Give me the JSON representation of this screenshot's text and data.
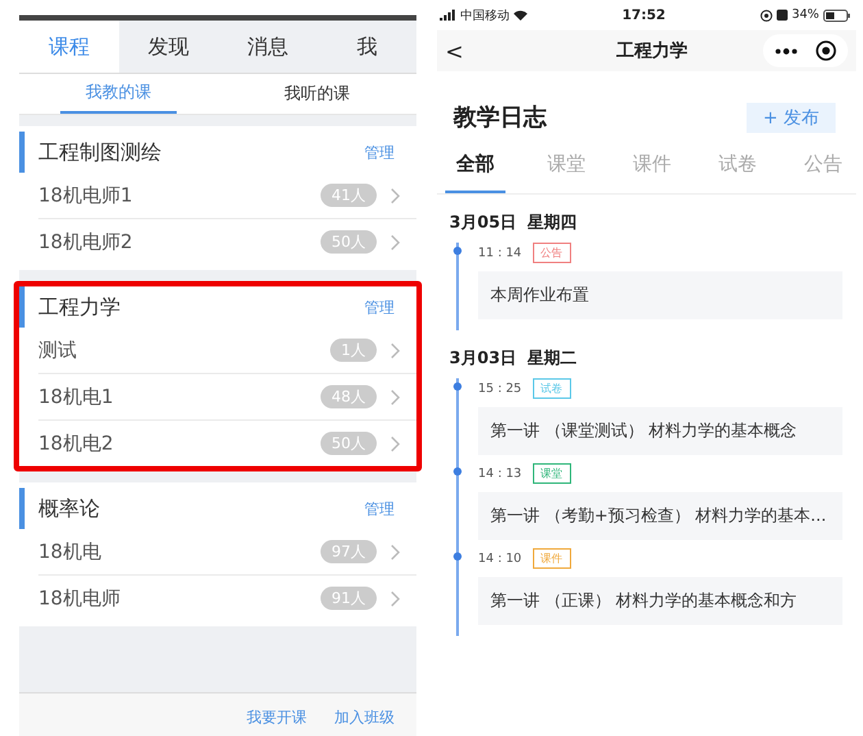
{
  "left": {
    "tabs": [
      {
        "label": "课程",
        "selected": true
      },
      {
        "label": "发现",
        "selected": false
      },
      {
        "label": "消息",
        "selected": false
      },
      {
        "label": "我",
        "selected": false
      }
    ],
    "subtabs": [
      {
        "label": "我教的课",
        "selected": true
      },
      {
        "label": "我听的课",
        "selected": false
      }
    ],
    "groups": [
      {
        "title": "工程制图测绘",
        "manage": "管理",
        "highlighted": false,
        "classes": [
          {
            "name": "18机电师1",
            "count": "41人"
          },
          {
            "name": "18机电师2",
            "count": "50人"
          }
        ]
      },
      {
        "title": "工程力学",
        "manage": "管理",
        "highlighted": true,
        "classes": [
          {
            "name": "测试",
            "count": "1人"
          },
          {
            "name": "18机电1",
            "count": "48人"
          },
          {
            "name": "18机电2",
            "count": "50人"
          }
        ]
      },
      {
        "title": "概率论",
        "manage": "管理",
        "highlighted": false,
        "classes": [
          {
            "name": "18机电",
            "count": "97人"
          },
          {
            "name": "18机电师",
            "count": "91人"
          }
        ]
      }
    ],
    "footer_links": [
      "我要开课",
      "加入班级"
    ]
  },
  "right": {
    "status_bar": {
      "carrier": "中国移动",
      "time": "17:52",
      "battery": "34%"
    },
    "nav": {
      "back": "<",
      "title": "工程力学"
    },
    "page_title": "教学日志",
    "publish_button": "+ 发布",
    "tabs": [
      {
        "label": "全部",
        "selected": true
      },
      {
        "label": "课堂",
        "selected": false
      },
      {
        "label": "课件",
        "selected": false
      },
      {
        "label": "试卷",
        "selected": false
      },
      {
        "label": "公告",
        "selected": false
      }
    ],
    "days": [
      {
        "date": "3月05日",
        "weekday": "星期四",
        "entries": [
          {
            "time": "11 : 14",
            "tag": "公告",
            "color": "#f08080",
            "text": "本周作业布置"
          }
        ]
      },
      {
        "date": "3月03日",
        "weekday": "星期二",
        "entries": [
          {
            "time": "15 : 25",
            "tag": "试卷",
            "color": "#5bc8e8",
            "text": "第一讲 （课堂测试） 材料力学的基本概念"
          },
          {
            "time": "14 : 13",
            "tag": "课堂",
            "color": "#2fb67a",
            "text": "第一讲 （考勤+预习检查） 材料力学的基本..."
          },
          {
            "time": "14 : 10",
            "tag": "课件",
            "color": "#f0a93c",
            "text": "第一讲 （正课） 材料力学的基本概念和方"
          }
        ]
      }
    ]
  }
}
